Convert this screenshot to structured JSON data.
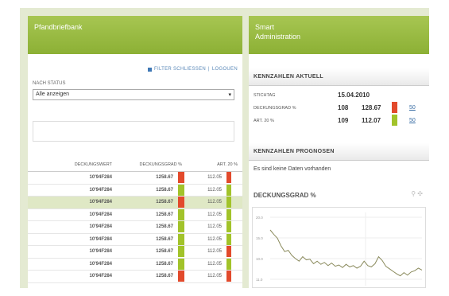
{
  "colors": {
    "frame": "#e4ead2",
    "header_green": "#97ba43",
    "bar_red": "#e24a2c",
    "bar_green": "#a2c32a",
    "row_highlight": "#dfe8c5",
    "link_blue": "#3a6ea5"
  },
  "left": {
    "title": "Pfandbriefbank",
    "links": {
      "filter": "FILTER SCHLIESSEN",
      "separator": "|",
      "logout": "LOGOUEN"
    },
    "status_label": "NACH STATUS",
    "status_value": "Alle anzeigen",
    "table": {
      "headers": [
        "DECKUNGSWERT",
        "DECKUNGSGRAD %",
        "ART. 20 %"
      ],
      "rows": [
        {
          "id": "10'94F284",
          "grad": "1258.67",
          "art": "112.05",
          "g_color": "#e24a2c",
          "a_color": "#e24a2c",
          "highlight": false
        },
        {
          "id": "10'94F284",
          "grad": "1258.67",
          "art": "112.05",
          "g_color": "#a2c32a",
          "a_color": "#a2c32a",
          "highlight": false
        },
        {
          "id": "10'94F284",
          "grad": "1258.67",
          "art": "112.05",
          "g_color": "#e24a2c",
          "a_color": "#a2c32a",
          "highlight": true
        },
        {
          "id": "10'94F284",
          "grad": "1258.67",
          "art": "112.05",
          "g_color": "#a2c32a",
          "a_color": "#a2c32a",
          "highlight": false
        },
        {
          "id": "10'94F284",
          "grad": "1258.67",
          "art": "112.05",
          "g_color": "#a2c32a",
          "a_color": "#a2c32a",
          "highlight": false
        },
        {
          "id": "10'94F284",
          "grad": "1258.67",
          "art": "112.05",
          "g_color": "#a2c32a",
          "a_color": "#a2c32a",
          "highlight": false
        },
        {
          "id": "10'94F284",
          "grad": "1258.67",
          "art": "112.05",
          "g_color": "#a2c32a",
          "a_color": "#e24a2c",
          "highlight": false
        },
        {
          "id": "10'94F284",
          "grad": "1258.67",
          "art": "112.05",
          "g_color": "#a2c32a",
          "a_color": "#a2c32a",
          "highlight": false
        },
        {
          "id": "10'94F284",
          "grad": "1258.67",
          "art": "112.05",
          "g_color": "#e24a2c",
          "a_color": "#e24a2c",
          "highlight": false
        }
      ]
    }
  },
  "right": {
    "title_line1": "Smart",
    "title_line2": "Administration",
    "kennzahlen_title": "KENNZAHLEN AKTUELL",
    "stichtag_label": "STICHTAG",
    "stichtag_value": "15.04.2010",
    "deckung_label": "DECKUNGSGRAD %",
    "deckung_v1": "108",
    "deckung_v2": "128.67",
    "deckung_color": "#e24a2c",
    "art_label": "ART. 20 %",
    "art_v1": "109",
    "art_v2": "112.07",
    "art_color": "#a2c32a",
    "link_text": "50",
    "prognosen_title": "KENNZAHLEN PROGNOSEN",
    "prognosen_text": "Es sind keine Daten vorhanden",
    "chart_title": "DECKUNGSGRAD %",
    "chart_icons": [
      "wrench-icon",
      "pin-icon"
    ]
  },
  "chart_data": {
    "type": "line",
    "title": "DECKUNGSGRAD %",
    "yticks": [
      "20.0",
      "15.0",
      "10.0",
      "11.0"
    ],
    "ylim": [
      10,
      21
    ],
    "grid": true,
    "series": [
      {
        "values": [
          18.5,
          17.8,
          17.2,
          16.0,
          15.1,
          15.3,
          14.5,
          14.0,
          13.6,
          14.3,
          13.8,
          13.9,
          13.2,
          13.6,
          13.1,
          13.4,
          12.9,
          13.3,
          12.8,
          13.0,
          12.6,
          13.1,
          12.7,
          12.9,
          12.5,
          12.8,
          13.6,
          12.9,
          12.7,
          13.2,
          14.3,
          13.7,
          12.8,
          12.4,
          12.0,
          11.6,
          11.3,
          11.8,
          11.4,
          11.9,
          12.1,
          12.5,
          12.2
        ]
      }
    ]
  }
}
